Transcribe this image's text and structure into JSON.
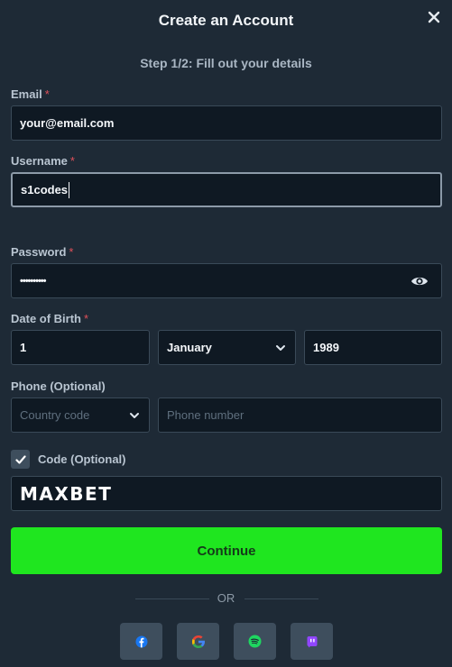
{
  "header": {
    "title": "Create an Account",
    "close_icon": "close-icon"
  },
  "step": "Step 1/2: Fill out your details",
  "form": {
    "email": {
      "label": "Email",
      "required_mark": "*",
      "value": "your@email.com"
    },
    "username": {
      "label": "Username",
      "required_mark": "*",
      "value": "s1codes"
    },
    "password": {
      "label": "Password",
      "required_mark": "*",
      "value": "••••••••••",
      "toggle_icon": "eye-icon"
    },
    "dob": {
      "label": "Date of Birth",
      "required_mark": "*",
      "day": "1",
      "month": "January",
      "year": "1989"
    },
    "phone": {
      "label": "Phone (Optional)",
      "country_placeholder": "Country code",
      "number_placeholder": "Phone number"
    },
    "code": {
      "label": "Code (Optional)",
      "checked": true,
      "value": "MAXBET"
    }
  },
  "continue_label": "Continue",
  "divider_text": "OR",
  "social": [
    {
      "icon": "facebook-icon",
      "color": "#1877f2"
    },
    {
      "icon": "google-icon",
      "color": "#ea4335"
    },
    {
      "icon": "spotify-icon",
      "color": "#1ed760"
    },
    {
      "icon": "twitch-icon",
      "color": "#9146ff"
    }
  ],
  "colors": {
    "background": "#1e2a36",
    "field_bg": "#0f1923",
    "accent": "#1fe61f",
    "required": "#e0505a"
  }
}
